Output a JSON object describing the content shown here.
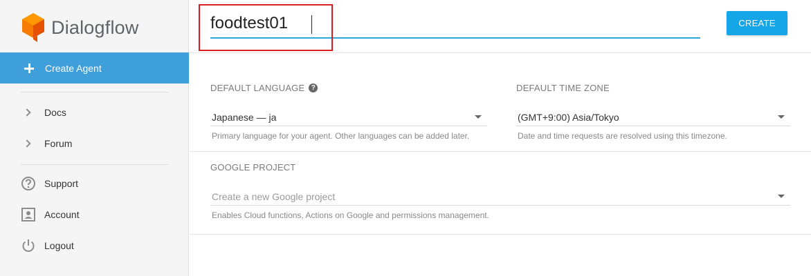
{
  "brand": {
    "name": "Dialogflow",
    "logo_color": "#f57c00"
  },
  "sidebar": {
    "create_agent": {
      "label": "Create Agent",
      "icon": "plus-icon"
    },
    "items": [
      {
        "label": "Docs",
        "icon": "chevron-right-icon"
      },
      {
        "label": "Forum",
        "icon": "chevron-right-icon"
      },
      {
        "label": "Support",
        "icon": "help-circle-icon"
      },
      {
        "label": "Account",
        "icon": "account-icon"
      },
      {
        "label": "Logout",
        "icon": "power-icon"
      }
    ]
  },
  "agent": {
    "name_value": "foodtest01",
    "create_label": "CREATE"
  },
  "language": {
    "label": "DEFAULT LANGUAGE",
    "value": "Japanese — ja",
    "hint": "Primary language for your agent. Other languages can be added later."
  },
  "timezone": {
    "label": "DEFAULT TIME ZONE",
    "value": "(GMT+9:00) Asia/Tokyo",
    "hint": "Date and time requests are resolved using this timezone."
  },
  "google_project": {
    "label": "GOOGLE PROJECT",
    "placeholder": "Create a new Google project",
    "hint": "Enables Cloud functions, Actions on Google and permissions management."
  },
  "colors": {
    "accent": "#3f9fdb",
    "button": "#14a6e7",
    "highlight": "#d81e1e"
  }
}
